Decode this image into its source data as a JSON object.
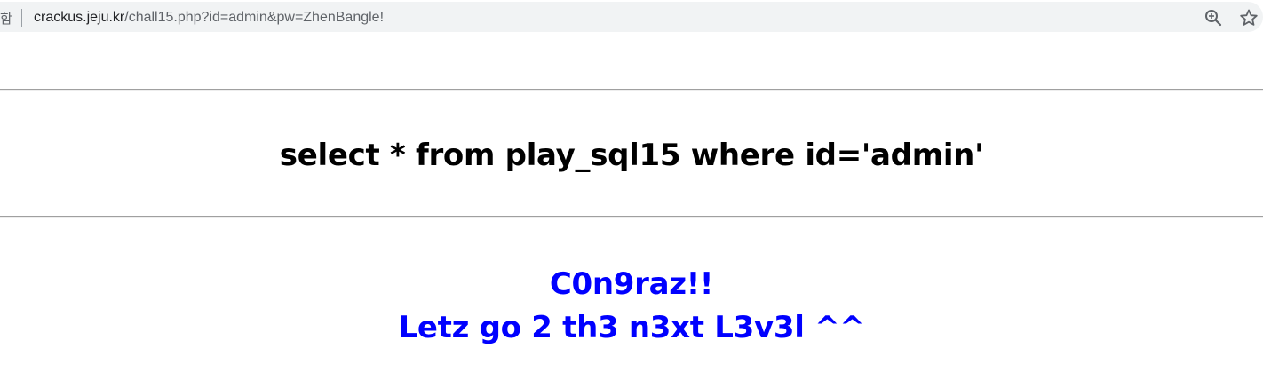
{
  "browser": {
    "security_label": "함",
    "url_host": "crackus.jeju.kr",
    "url_path": "/chall15.php?id=admin&pw=ZhenBangle!",
    "icons": [
      "zoom-icon",
      "bookmark-star-icon"
    ]
  },
  "page": {
    "query_text": "select * from play_sql15 where id='admin'",
    "success_line1": "C0n9raz!!",
    "success_line2": "Letz go 2 th3 n3xt L3v3l ^^",
    "message_color": "#0000ff"
  }
}
